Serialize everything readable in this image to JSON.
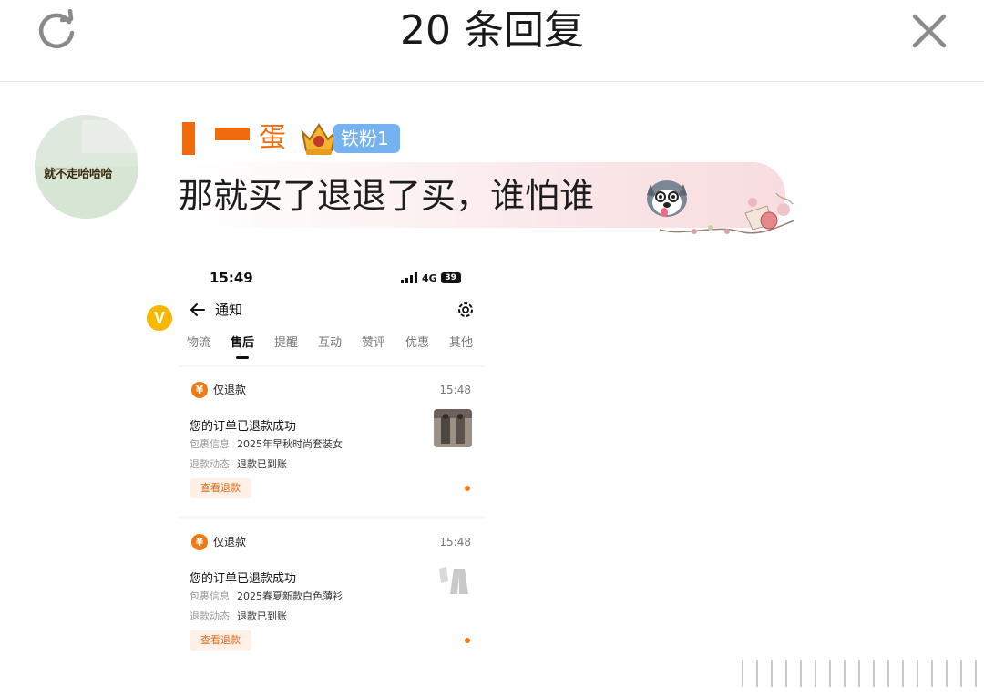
{
  "header": {
    "title": "20 条回复",
    "refresh_icon": "refresh-icon",
    "close_icon": "close-icon"
  },
  "comment": {
    "avatar_text": "就不走哈哈哈",
    "verified_badge": "V",
    "username": "蛋",
    "fan_badge": "铁粉1",
    "text": "那就买了退退了买，谁怕谁",
    "emoji": "husky-dog-emoji"
  },
  "screenshot": {
    "status_time": "15:49",
    "network": "4G",
    "battery": "39",
    "nav_title": "通知",
    "tabs": [
      "物流",
      "售后",
      "提醒",
      "互动",
      "赞评",
      "优惠",
      "其他"
    ],
    "active_tab": "售后",
    "cards": [
      {
        "icon": "¥",
        "type": "仅退款",
        "time": "15:48",
        "heading": "您的订单已退款成功",
        "package_label": "包裹信息",
        "package_value": "2025年早秋时尚套装女",
        "status_label": "退款动态",
        "status_value": "退款已到账",
        "button": "查看退款"
      },
      {
        "icon": "¥",
        "type": "仅退款",
        "time": "15:48",
        "heading": "您的订单已退款成功",
        "package_label": "包裹信息",
        "package_value": "2025春夏新款白色薄衫",
        "status_label": "退款动态",
        "status_value": "退款已到账",
        "button": "查看退款"
      }
    ]
  },
  "colors": {
    "accent_orange": "#f06a0e",
    "fan_badge_blue": "#74b3f0",
    "verified_yellow": "#f6b800"
  }
}
